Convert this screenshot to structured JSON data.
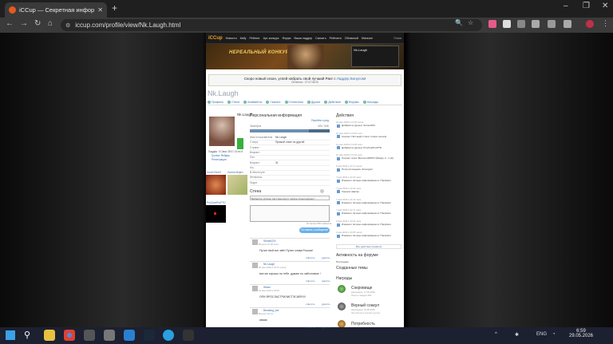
{
  "browser": {
    "tab_title": "iCCup — Секретная информац",
    "url": "iccup.com/profile/view/Nk.Laugh.html"
  },
  "site": {
    "nav": [
      "Новости",
      "Кабу",
      "Рейтинг",
      "Арт-конкурс",
      "Форум",
      "Ваши ладдер",
      "Скачать",
      "Рейтинги",
      "Облачный",
      "Магазин"
    ],
    "search": "Поиск",
    "banner": "НЕРЕАЛЬНЫЙ КОНКУРС",
    "userbox_name": "Nk.Laugh"
  },
  "announce": {
    "text_pre": "Скоро новый сезон, успей набрать свой лучший Ранг с ",
    "link": "Ладдер Бонусом",
    "text_post": "!",
    "sub": "Осталось : 27:47:34:03"
  },
  "profile": {
    "nick": "Nk.Laugh",
    "tabs": [
      "Профиль",
      "Стена",
      "Ачивменты",
      "Скачать",
      "Статистика",
      "Друзья",
      "Действия",
      "Форумы",
      "Награды"
    ],
    "side_name": "Nk.Laugh",
    "side_lines": [
      "Ладдер: 3 Свои 25.07.15 из 5",
      "Группа: Вейдер",
      "Регистрация"
    ],
    "friends": [
      "Gordi.FerriiX",
      "Guerra.Ninjex",
      "ProZoneProPTD"
    ]
  },
  "personal": {
    "title": "Персональная информация",
    "edit": "Перейти к ред.",
    "xp_label": "Эксперта",
    "xp_value": "403 / 546",
    "xp_fraction": 0.74,
    "rows": [
      {
        "k": "Имя пользователя",
        "v": "Nk.Laugh"
      },
      {
        "k": "Статус",
        "v": "Прямой ответ из другой"
      },
      {
        "k": "Страна",
        "v": ""
      },
      {
        "k": "Возраст",
        "v": ""
      },
      {
        "k": "Пол",
        "v": ""
      },
      {
        "k": "Возраст",
        "v": "31"
      },
      {
        "k": "Icq",
        "v": ""
      },
      {
        "k": "В Институте",
        "v": ""
      },
      {
        "k": "Интересы",
        "v": ""
      },
      {
        "k": "Skype",
        "v": ""
      }
    ]
  },
  "wall": {
    "title": "Стена",
    "select": "Выберите (стена)",
    "select2": "На стене могут писать только друзья !",
    "counter": "Осталось 500 символов",
    "send": "Оставить сообщение",
    "comments": [
      {
        "name": "Sensei224",
        "date": "Вчера в 21:38 часа",
        "text": "Путин твой вот звёт Путин слава России!"
      },
      {
        "name": "Nk.Laugh",
        "date": "20 мая 2026 в 20:10 часов",
        "text": "все же хорошо по тебе, думаю ты заботливое !"
      },
      {
        "name": "Wisen",
        "date": "19 мая 2026 в 18:05",
        "text": "ОРИ ЯРОСЛАСТРИЛИСТЭСИЙ!!!!!!"
      },
      {
        "name": "Breaking_bot",
        "date": "Вчера в 02:14",
        "text": "авааа"
      }
    ],
    "actions": [
      "ответить",
      "удалить"
    ]
  },
  "activity": {
    "title": "Действия",
    "items": [
      {
        "d": "18 мая 2026 в 14:29 часов",
        "t": "Добавил в друзья: Sensei224"
      },
      {
        "d": "16 мая 2026 в 16:48 часа",
        "t": "Сыграл: Nk.Laugh стали только на нём"
      },
      {
        "d": "14 мая 2026 в 13:08 часа",
        "t": "Добавил в друзья: ProZoneProPTD"
      },
      {
        "d": "10 мая 2026 в 13:34 часа",
        "t": "Сыграл: игра: BunnecuthPRV (Mappy d - 1 eb)"
      },
      {
        "d": "8 мая 2026 в 11:11 часов",
        "t": "Получил медаль: Emergent"
      },
      {
        "d": "7 мая 2026 в 14:09 часа",
        "t": "Изменил личную информацию в: Профиле"
      },
      {
        "d": "7 мая 2026 в 14:09 часа",
        "t": "Сменил аватар"
      },
      {
        "d": "7 мая 2026 в 14:10 часа",
        "t": "Изменил личную информацию в: Профиле"
      },
      {
        "d": "7 мая 2026 в 14:11 часа",
        "t": "Изменил личную информацию в: Профиле"
      },
      {
        "d": "3 мая 2026 в 10:24 часа",
        "t": "Изменил личную информацию в: Профиле"
      },
      {
        "d": "2 мая 2026 в 13:08 часов",
        "t": "Изменил личную информацию в: Профиле"
      }
    ],
    "all": "Все действия профиля",
    "forum_title": "Активность на форуме",
    "forum_sub1": "Последнее",
    "forum_sub2": "Созданные темы",
    "awards_title": "Награды",
    "awards": [
      {
        "n": "Сокровище",
        "d": "Награжден: 17.05.2026",
        "s": "Пиши с каждой 300"
      },
      {
        "n": "Верный соакул",
        "d": "Награжден: 15.05.2026",
        "s": "За участие в игр все группе"
      },
      {
        "n": "Потребность",
        "d": "",
        "s": ""
      }
    ]
  },
  "taskbar": {
    "time": "6:59",
    "date": "29.05.2026",
    "lang": "ENG"
  }
}
